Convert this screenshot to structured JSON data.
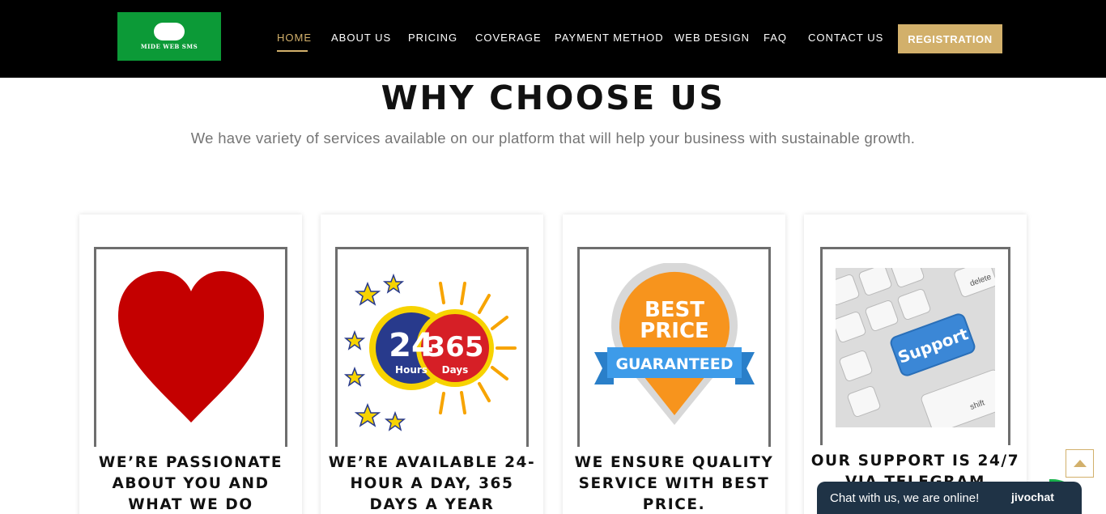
{
  "brand": {
    "logo_text": "MIDE WEB SMS"
  },
  "nav": {
    "items": [
      {
        "label": "HOME"
      },
      {
        "label": "ABOUT US"
      },
      {
        "label": "PRICING"
      },
      {
        "label": "COVERAGE"
      },
      {
        "label": "PAYMENT METHOD"
      },
      {
        "label": "WEB DESIGN"
      },
      {
        "label": "FAQ"
      },
      {
        "label": "CONTACT US"
      }
    ],
    "active": "HOME",
    "cta_label": "REGISTRATION"
  },
  "section": {
    "title": "WHY CHOOSE US",
    "subtitle": "We have variety of services available on our platform that will help your business with sustainable growth."
  },
  "cards": [
    {
      "icon": "heart-icon",
      "text": "WE’RE PASSIONATE ABOUT YOU AND WHAT WE DO"
    },
    {
      "icon": "clock-24-365-icon",
      "text": "WE’RE AVAILABLE 24-HOUR A DAY, 365 DAYS A YEAR",
      "badge_left": "24",
      "badge_left_sub": "Hours",
      "badge_right": "365",
      "badge_right_sub": "Days"
    },
    {
      "icon": "best-price-badge-icon",
      "text": "WE ENSURE QUALITY SERVICE WITH BEST PRICE.",
      "badge_line1": "BEST",
      "badge_line2": "PRICE",
      "ribbon": "GUARANTEED"
    },
    {
      "icon": "support-keyboard-icon",
      "text": "OUR SUPPORT IS 24/7 VIA TELEGRAM",
      "key_label": "Support",
      "key_delete": "delete",
      "key_shift": "shift"
    }
  ],
  "chat": {
    "text": "Chat with us, we are online!",
    "brand": "jivochat"
  },
  "colors": {
    "accent": "#d2b06b",
    "nav_bg": "#000000",
    "logo_bg": "#0c9a37",
    "heart": "#c40000",
    "chat_bg": "#1f3346"
  }
}
